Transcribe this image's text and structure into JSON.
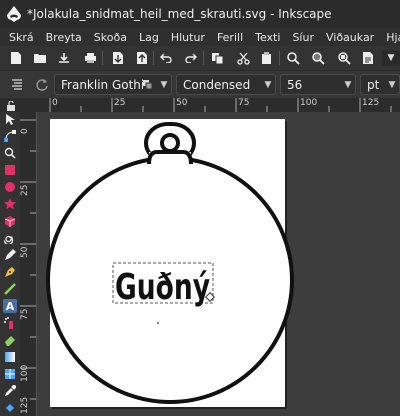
{
  "window": {
    "title": "*Jolakula_snidmat_heil_med_skrauti.svg - Inkscape"
  },
  "menu": [
    "Skrá",
    "Breyta",
    "Skoða",
    "Lag",
    "Hlutur",
    "Ferill",
    "Texti",
    "Síur",
    "Viðaukar",
    "Hjálp"
  ],
  "text_toolbar": {
    "font_family": "Franklin Gothic M",
    "font_style": "Condensed",
    "font_size": "56",
    "unit": "pt"
  },
  "ruler": {
    "h_labels": [
      "0",
      "25",
      "50",
      "75",
      "100",
      "125"
    ],
    "v_labels": [
      "0",
      "25",
      "50",
      "75",
      "100",
      "125"
    ]
  },
  "canvas": {
    "text": "Guðný"
  },
  "colors": {
    "accent": "#4da3ff",
    "chrome": "#333333",
    "canvas_bg": "#3d3d3d",
    "page": "#ffffff",
    "stroke": "#111111"
  }
}
